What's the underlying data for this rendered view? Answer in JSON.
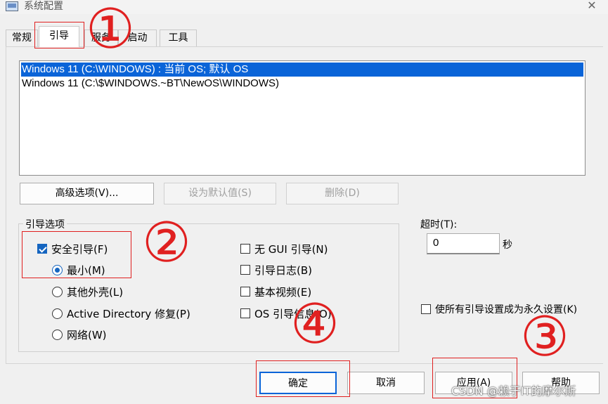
{
  "window": {
    "title": "系统配置",
    "close_symbol": "✕"
  },
  "tabs": [
    {
      "label": "常规",
      "active": false
    },
    {
      "label": "引导",
      "active": true
    },
    {
      "label": "服务",
      "active": false
    },
    {
      "label": "启动",
      "active": false
    },
    {
      "label": "工具",
      "active": false
    }
  ],
  "os_list": [
    {
      "label": "Windows 11 (C:\\WINDOWS) : 当前 OS; 默认 OS",
      "selected": true
    },
    {
      "label": "Windows 11 (C:\\$WINDOWS.~BT\\NewOS\\WINDOWS)",
      "selected": false
    }
  ],
  "list_buttons": {
    "advanced": "高级选项(V)...",
    "set_default": "设为默认值(S)",
    "delete": "删除(D)"
  },
  "boot_options": {
    "title": "引导选项",
    "safe_boot": {
      "label": "安全引导(F)",
      "checked": true
    },
    "radios": [
      {
        "label": "最小(M)",
        "checked": true
      },
      {
        "label": "其他外壳(L)",
        "checked": false
      },
      {
        "label": "Active Directory 修复(P)",
        "checked": false
      },
      {
        "label": "网络(W)",
        "checked": false
      }
    ],
    "checkboxes": [
      {
        "label": "无 GUI 引导(N)",
        "checked": false
      },
      {
        "label": "引导日志(B)",
        "checked": false
      },
      {
        "label": "基本视频(E)",
        "checked": false
      },
      {
        "label": "OS 引导信息(O)",
        "checked": false
      }
    ]
  },
  "timeout": {
    "label": "超时(T):",
    "value": "0",
    "unit": "秒"
  },
  "permanent": {
    "label": "使所有引导设置成为永久设置(K)",
    "checked": false
  },
  "bottom_buttons": {
    "ok": "确定",
    "cancel": "取消",
    "apply": "应用(A)",
    "help": "帮助"
  },
  "annotations": [
    "①",
    "②",
    "③",
    "④"
  ],
  "watermark": "CSDN @赖于IT的摩尔斯",
  "colors": {
    "selection": "#0a64d8",
    "annotation": "#e02020",
    "checked": "#1565c0"
  }
}
